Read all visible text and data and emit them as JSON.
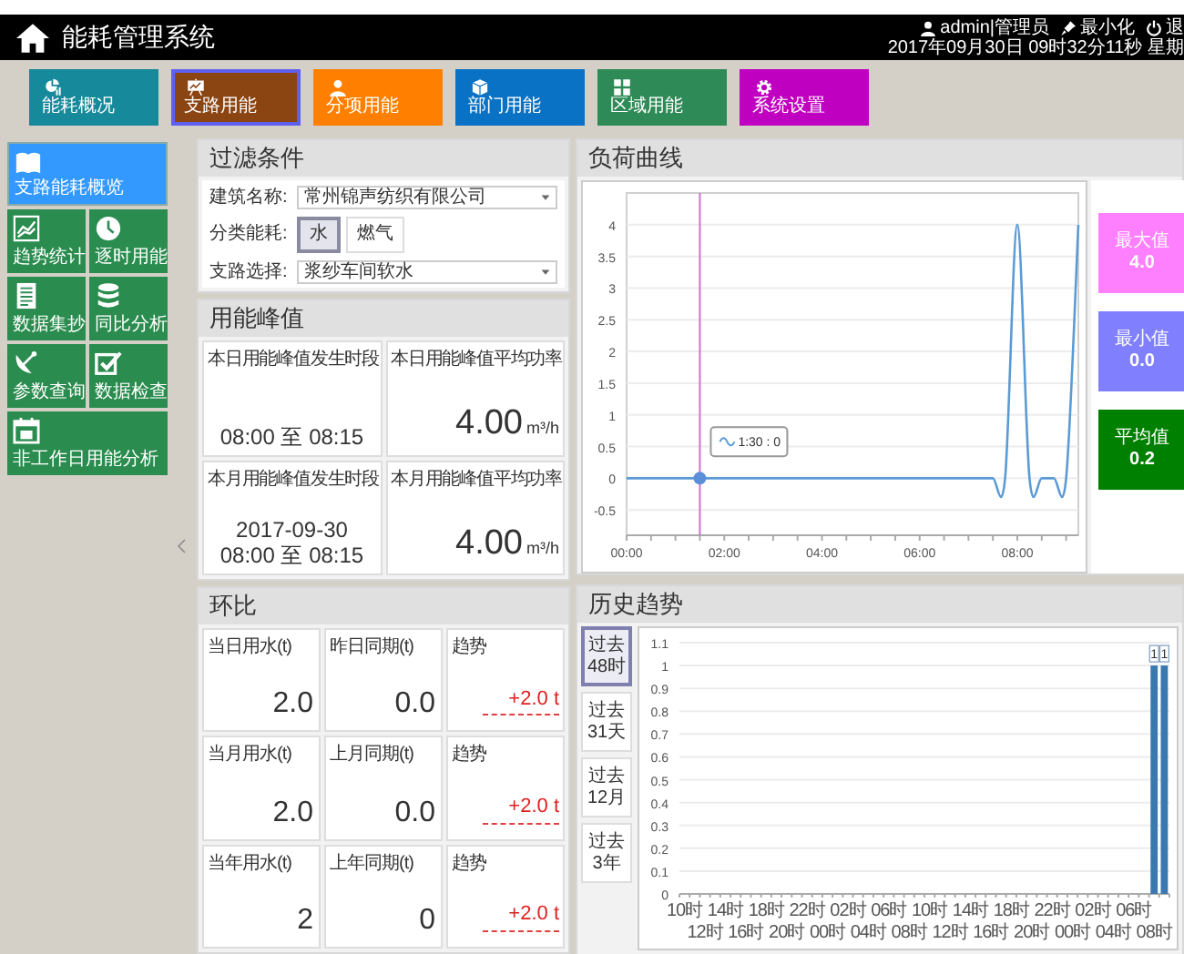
{
  "header": {
    "title": "能耗管理系统",
    "user": "admin|管理员",
    "minimize": "最小化",
    "logout": "退",
    "datetime": "2017年09月30日 09时32分11秒 星期"
  },
  "nav": [
    {
      "label": "能耗概况",
      "color": "#16899a",
      "selected": false
    },
    {
      "label": "支路用能",
      "color": "#8b4513",
      "selected": true
    },
    {
      "label": "分项用能",
      "color": "#ff8000",
      "selected": false
    },
    {
      "label": "部门用能",
      "color": "#0a72c4",
      "selected": false
    },
    {
      "label": "区域用能",
      "color": "#2e8b57",
      "selected": false
    },
    {
      "label": "系统设置",
      "color": "#c000c0",
      "selected": false
    }
  ],
  "sidebar": [
    {
      "kind": "full",
      "label": "支路能耗概览",
      "selected": true
    },
    {
      "kind": "half",
      "label": "趋势统计",
      "selected": false
    },
    {
      "kind": "half",
      "label": "逐时用能",
      "selected": false
    },
    {
      "kind": "half",
      "label": "数据集抄",
      "selected": false
    },
    {
      "kind": "half",
      "label": "同比分析",
      "selected": false
    },
    {
      "kind": "half",
      "label": "参数查询",
      "selected": false
    },
    {
      "kind": "half",
      "label": "数据检查",
      "selected": false
    },
    {
      "kind": "full",
      "label": "非工作日用能分析",
      "selected": false
    }
  ],
  "filter": {
    "title": "过滤条件",
    "building": {
      "label": "建筑名称:",
      "value": "常州锦声纺织有限公司"
    },
    "category": {
      "label": "分类能耗:",
      "options": [
        {
          "label": "水",
          "selected": true
        },
        {
          "label": "燃气",
          "selected": false
        }
      ]
    },
    "branch": {
      "label": "支路选择:",
      "value": "浆纱车间软水"
    }
  },
  "peak": {
    "title": "用能峰值",
    "cards": [
      {
        "kind": "time",
        "title": "本日用能峰值发生时段",
        "value": "08:00 至 08:15"
      },
      {
        "kind": "power",
        "title": "本日用能峰值平均功率",
        "value": "4.00",
        "unit": "m³/h"
      },
      {
        "kind": "time",
        "title": "本月用能峰值发生时段",
        "date": "2017-09-30",
        "value": "08:00 至 08:15"
      },
      {
        "kind": "power",
        "title": "本月用能峰值平均功率",
        "value": "4.00",
        "unit": "m³/h"
      }
    ]
  },
  "load": {
    "title": "负荷曲线",
    "chart_data": {
      "type": "line",
      "x": [
        0,
        0.25,
        0.5,
        0.75,
        1,
        1.25,
        1.5,
        1.75,
        2,
        2.25,
        2.5,
        2.75,
        3,
        3.25,
        3.5,
        3.75,
        4,
        4.25,
        4.5,
        4.75,
        5,
        5.25,
        5.5,
        5.75,
        6,
        6.25,
        6.5,
        6.75,
        7,
        7.25,
        7.5,
        7.75,
        8,
        8.25,
        8.5,
        8.75,
        9,
        9.25
      ],
      "series": [
        {
          "color": "#5b9bd5",
          "values": [
            0,
            0,
            0,
            0,
            0,
            0,
            0,
            0,
            0,
            0,
            0,
            0,
            0,
            0,
            0,
            0,
            0,
            0,
            0,
            0,
            0,
            0,
            0,
            0,
            0,
            0,
            0,
            0,
            0,
            0,
            0,
            0,
            4,
            0,
            0,
            0,
            0,
            4
          ]
        }
      ],
      "xlim": [
        0,
        9.25
      ],
      "ylim": [
        -0.9,
        4.5
      ],
      "xticks": [
        {
          "value": 0,
          "label": "00:00"
        },
        {
          "value": 2,
          "label": "02:00"
        },
        {
          "value": 4,
          "label": "04:00"
        },
        {
          "value": 6,
          "label": "06:00"
        },
        {
          "value": 8,
          "label": "08:00"
        }
      ],
      "yticks": [
        -0.5,
        0,
        0.5,
        1,
        1.5,
        2,
        2.5,
        3,
        3.5,
        4
      ],
      "grid": true,
      "ref_lines": [
        {
          "axis": "x",
          "value": 1.5,
          "color": "#d070d0"
        }
      ],
      "annotations": [
        "1:30 : 0"
      ]
    },
    "stats": [
      {
        "label": "最大值",
        "value": "4.0",
        "color": "#ff80ff"
      },
      {
        "label": "最小值",
        "value": "0.0",
        "color": "#8080ff"
      },
      {
        "label": "平均值",
        "value": "0.2",
        "color": "#008000"
      }
    ]
  },
  "ratio": {
    "title": "环比",
    "rows": [
      {
        "cells": [
          {
            "kind": "value",
            "label": "当日用水(t)",
            "value": "2.0"
          },
          {
            "kind": "value",
            "label": "昨日同期(t)",
            "value": "0.0"
          },
          {
            "kind": "trend",
            "label": "趋势",
            "value": "+2.0 t"
          }
        ]
      },
      {
        "cells": [
          {
            "kind": "value",
            "label": "当月用水(t)",
            "value": "2.0"
          },
          {
            "kind": "value",
            "label": "上月同期(t)",
            "value": "0.0"
          },
          {
            "kind": "trend",
            "label": "趋势",
            "value": "+2.0 t"
          }
        ]
      },
      {
        "cells": [
          {
            "kind": "value",
            "label": "当年用水(t)",
            "value": "2"
          },
          {
            "kind": "value",
            "label": "上年同期(t)",
            "value": "0"
          },
          {
            "kind": "trend",
            "label": "趋势",
            "value": "+2.0 t"
          }
        ]
      }
    ]
  },
  "history": {
    "title": "历史趋势",
    "ranges": [
      {
        "label": "过去\n48时",
        "selected": true
      },
      {
        "label": "过去\n31天",
        "selected": false
      },
      {
        "label": "过去\n12月",
        "selected": false
      },
      {
        "label": "过去\n3年",
        "selected": false
      }
    ],
    "chart_data": {
      "type": "bar",
      "categories": [
        "10时",
        null,
        "12时",
        null,
        "14时",
        null,
        "16时",
        null,
        "18时",
        null,
        "20时",
        null,
        "22时",
        null,
        "00时",
        null,
        "02时",
        null,
        "04时",
        null,
        "06时",
        null,
        "08时",
        null,
        "10时",
        null,
        "12时",
        null,
        "14时",
        null,
        "16时",
        null,
        "18时",
        null,
        "20时",
        null,
        "22时",
        null,
        "00时",
        null,
        "02时",
        null,
        "04时",
        null,
        "06时",
        null,
        "08时",
        null
      ],
      "series": [
        {
          "color": "#3a78b0",
          "values": [
            null,
            null,
            null,
            null,
            null,
            null,
            null,
            null,
            null,
            null,
            null,
            null,
            null,
            null,
            null,
            null,
            null,
            null,
            null,
            null,
            null,
            null,
            null,
            null,
            null,
            null,
            null,
            null,
            null,
            null,
            null,
            null,
            null,
            null,
            null,
            null,
            null,
            null,
            null,
            null,
            null,
            null,
            null,
            null,
            null,
            null,
            1,
            1
          ]
        }
      ],
      "ylim": [
        0,
        1.1
      ],
      "yticks": [
        0,
        0.1,
        0.2,
        0.3,
        0.4,
        0.5,
        0.6,
        0.7,
        0.8,
        0.9,
        1,
        1.1
      ],
      "grid": true,
      "data_labels": true
    }
  }
}
